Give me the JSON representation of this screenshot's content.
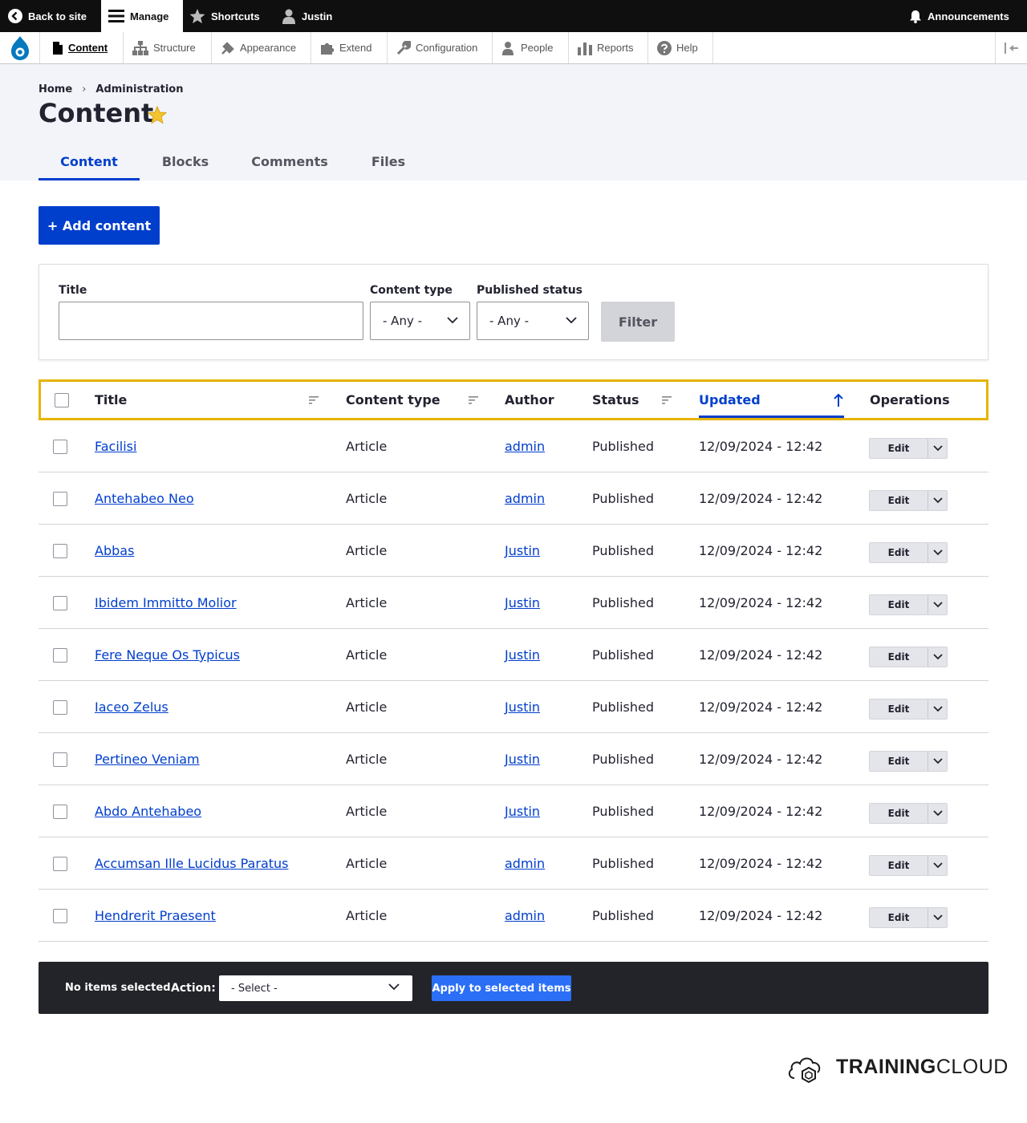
{
  "toolbar": {
    "back_to_site": "Back to site",
    "manage": "Manage",
    "shortcuts": "Shortcuts",
    "user": "Justin",
    "announcements": "Announcements"
  },
  "menu": {
    "items": [
      {
        "label": "Content",
        "icon": "page-icon"
      },
      {
        "label": "Structure",
        "icon": "sitemap-icon"
      },
      {
        "label": "Appearance",
        "icon": "paintbrush-icon"
      },
      {
        "label": "Extend",
        "icon": "puzzle-icon"
      },
      {
        "label": "Configuration",
        "icon": "wrench-icon"
      },
      {
        "label": "People",
        "icon": "person-icon"
      },
      {
        "label": "Reports",
        "icon": "bar-chart-icon"
      },
      {
        "label": "Help",
        "icon": "help-icon"
      }
    ]
  },
  "breadcrumb": {
    "home": "Home",
    "admin": "Administration"
  },
  "page": {
    "title": "Content"
  },
  "tabs": [
    "Content",
    "Blocks",
    "Comments",
    "Files"
  ],
  "actions": {
    "add_content": "+ Add content"
  },
  "filters": {
    "title_label": "Title",
    "title_value": "",
    "type_label": "Content type",
    "type_value": "- Any -",
    "status_label": "Published status",
    "status_value": "- Any -",
    "filter_button": "Filter"
  },
  "table": {
    "headers": {
      "title": "Title",
      "type": "Content type",
      "author": "Author",
      "status": "Status",
      "updated": "Updated",
      "operations": "Operations"
    },
    "rows": [
      {
        "title": "Facilisi",
        "type": "Article",
        "author": "admin",
        "status": "Published",
        "updated": "12/09/2024 - 12:42",
        "op": "Edit"
      },
      {
        "title": "Antehabeo Neo",
        "type": "Article",
        "author": "admin",
        "status": "Published",
        "updated": "12/09/2024 - 12:42",
        "op": "Edit"
      },
      {
        "title": "Abbas",
        "type": "Article",
        "author": "Justin",
        "status": "Published",
        "updated": "12/09/2024 - 12:42",
        "op": "Edit"
      },
      {
        "title": "Ibidem Immitto Molior",
        "type": "Article",
        "author": "Justin",
        "status": "Published",
        "updated": "12/09/2024 - 12:42",
        "op": "Edit"
      },
      {
        "title": "Fere Neque Os Typicus",
        "type": "Article",
        "author": "Justin",
        "status": "Published",
        "updated": "12/09/2024 - 12:42",
        "op": "Edit"
      },
      {
        "title": "Iaceo Zelus",
        "type": "Article",
        "author": "Justin",
        "status": "Published",
        "updated": "12/09/2024 - 12:42",
        "op": "Edit"
      },
      {
        "title": "Pertineo Veniam",
        "type": "Article",
        "author": "Justin",
        "status": "Published",
        "updated": "12/09/2024 - 12:42",
        "op": "Edit"
      },
      {
        "title": "Abdo Antehabeo",
        "type": "Article",
        "author": "Justin",
        "status": "Published",
        "updated": "12/09/2024 - 12:42",
        "op": "Edit"
      },
      {
        "title": "Accumsan Ille Lucidus Paratus",
        "type": "Article",
        "author": "admin",
        "status": "Published",
        "updated": "12/09/2024 - 12:42",
        "op": "Edit"
      },
      {
        "title": "Hendrerit Praesent",
        "type": "Article",
        "author": "admin",
        "status": "Published",
        "updated": "12/09/2024 - 12:42",
        "op": "Edit"
      }
    ]
  },
  "bulk": {
    "selected": "No items selected",
    "action_label": "Action:",
    "action_value": "- Select -",
    "apply": "Apply to selected items"
  },
  "branding": {
    "logo_bold": "TRAINING",
    "logo_light": "CLOUD"
  },
  "colors": {
    "accent": "#003ecc",
    "highlight": "#e6b400",
    "toolbar": "#0f0f0f",
    "bulk_bar": "#232429"
  }
}
